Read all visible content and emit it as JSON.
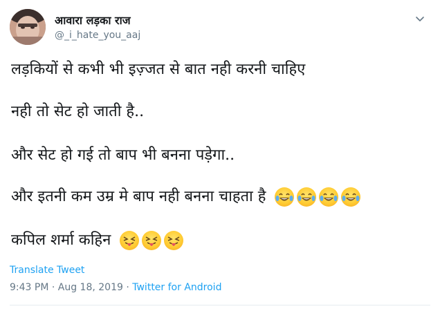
{
  "user": {
    "display_name": "आवारा लड़का राज",
    "handle": "@_i_hate_you_aaj"
  },
  "tweet": {
    "line1": "लड़कियों से कभी भी इज़्जत से बात नही करनी चाहिए",
    "line2": "नही तो सेट हो जाती है..",
    "line3": "और सेट हो गई तो बाप भी बनना पड़ेगा..",
    "line4": "और इतनी कम उम्र मे बाप नही बनना चाहता है",
    "line5": "कपिल शर्मा कहिन",
    "line4_emoji": [
      "tears-of-joy",
      "tears-of-joy",
      "tears-of-joy",
      "tears-of-joy"
    ],
    "line5_emoji": [
      "squinting-tongue",
      "squinting-tongue",
      "squinting-tongue"
    ]
  },
  "translate_label": "Translate Tweet",
  "meta": {
    "time_date": "9:43 PM · Aug 18, 2019 · ",
    "source": "Twitter for Android"
  },
  "icons": {
    "caret": "chevron-down-icon"
  },
  "colors": {
    "link": "#1da1f2",
    "secondary_text": "#657786",
    "primary_text": "#14171a"
  }
}
